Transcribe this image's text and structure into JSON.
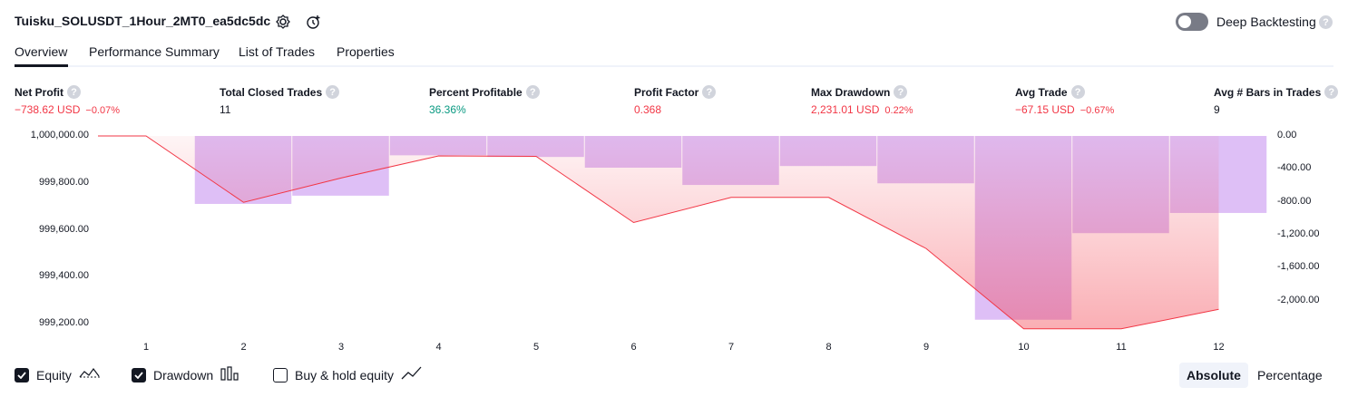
{
  "header": {
    "title": "Tuisku_SOLUSDT_1Hour_2MT0_ea5dc5dc",
    "deep_backtesting_label": "Deep Backtesting",
    "help_glyph": "?"
  },
  "tabs": [
    {
      "label": "Overview",
      "active": true
    },
    {
      "label": "Performance Summary",
      "active": false
    },
    {
      "label": "List of Trades",
      "active": false
    },
    {
      "label": "Properties",
      "active": false
    }
  ],
  "metrics": [
    {
      "label": "Net Profit",
      "value": "−738.62 USD",
      "pct": "−0.07%",
      "color": "#f23645"
    },
    {
      "label": "Total Closed Trades",
      "value": "11",
      "pct": "",
      "color": "#131722"
    },
    {
      "label": "Percent Profitable",
      "value": "36.36%",
      "pct": "",
      "color": "#089981"
    },
    {
      "label": "Profit Factor",
      "value": "0.368",
      "pct": "",
      "color": "#f23645"
    },
    {
      "label": "Max Drawdown",
      "value": "2,231.01 USD",
      "pct": "0.22%",
      "color": "#f23645"
    },
    {
      "label": "Avg Trade",
      "value": "−67.15 USD",
      "pct": "−0.67%",
      "color": "#f23645"
    },
    {
      "label": "Avg # Bars in Trades",
      "value": "9",
      "pct": "",
      "color": "#131722"
    }
  ],
  "chart_data": {
    "type": "line",
    "x": [
      1,
      2,
      3,
      4,
      5,
      6,
      7,
      8,
      9,
      10,
      11,
      12
    ],
    "left_ticks": [
      "1,000,000.00",
      "999,800.00",
      "999,600.00",
      "999,400.00",
      "999,200.00"
    ],
    "right_ticks": [
      "0.00",
      "-400.00",
      "-800.00",
      "-1,200.00",
      "-1,600.00",
      "-2,000.00"
    ],
    "left_ylim": [
      999150,
      1000000
    ],
    "right_ylim": [
      -2300,
      0
    ],
    "series": [
      {
        "name": "Equity",
        "axis": "left",
        "color": "#f23645",
        "values": [
          1000000,
          999717,
          999821,
          999915,
          999913,
          999631,
          999738,
          999738,
          999520,
          999178,
          999178,
          999261
        ]
      },
      {
        "name": "Drawdown",
        "axis": "right",
        "color": "#ce93d8",
        "values": [
          0,
          -825,
          -725,
          -235,
          -255,
          -385,
          -595,
          -365,
          -575,
          -2231,
          -1180,
          -935
        ]
      }
    ],
    "buy_hold": {
      "name": "Buy & hold equity",
      "enabled": false
    }
  },
  "legend": [
    {
      "label": "Equity",
      "checked": true
    },
    {
      "label": "Drawdown",
      "checked": true
    },
    {
      "label": "Buy & hold equity",
      "checked": false
    }
  ],
  "view_modes": {
    "absolute": "Absolute",
    "percentage": "Percentage",
    "active": "Absolute"
  },
  "colors": {
    "equity_line": "#f23645",
    "drawdown_bar": "#d8b4f5",
    "text": "#131722",
    "toggle_off": "#787b86"
  }
}
